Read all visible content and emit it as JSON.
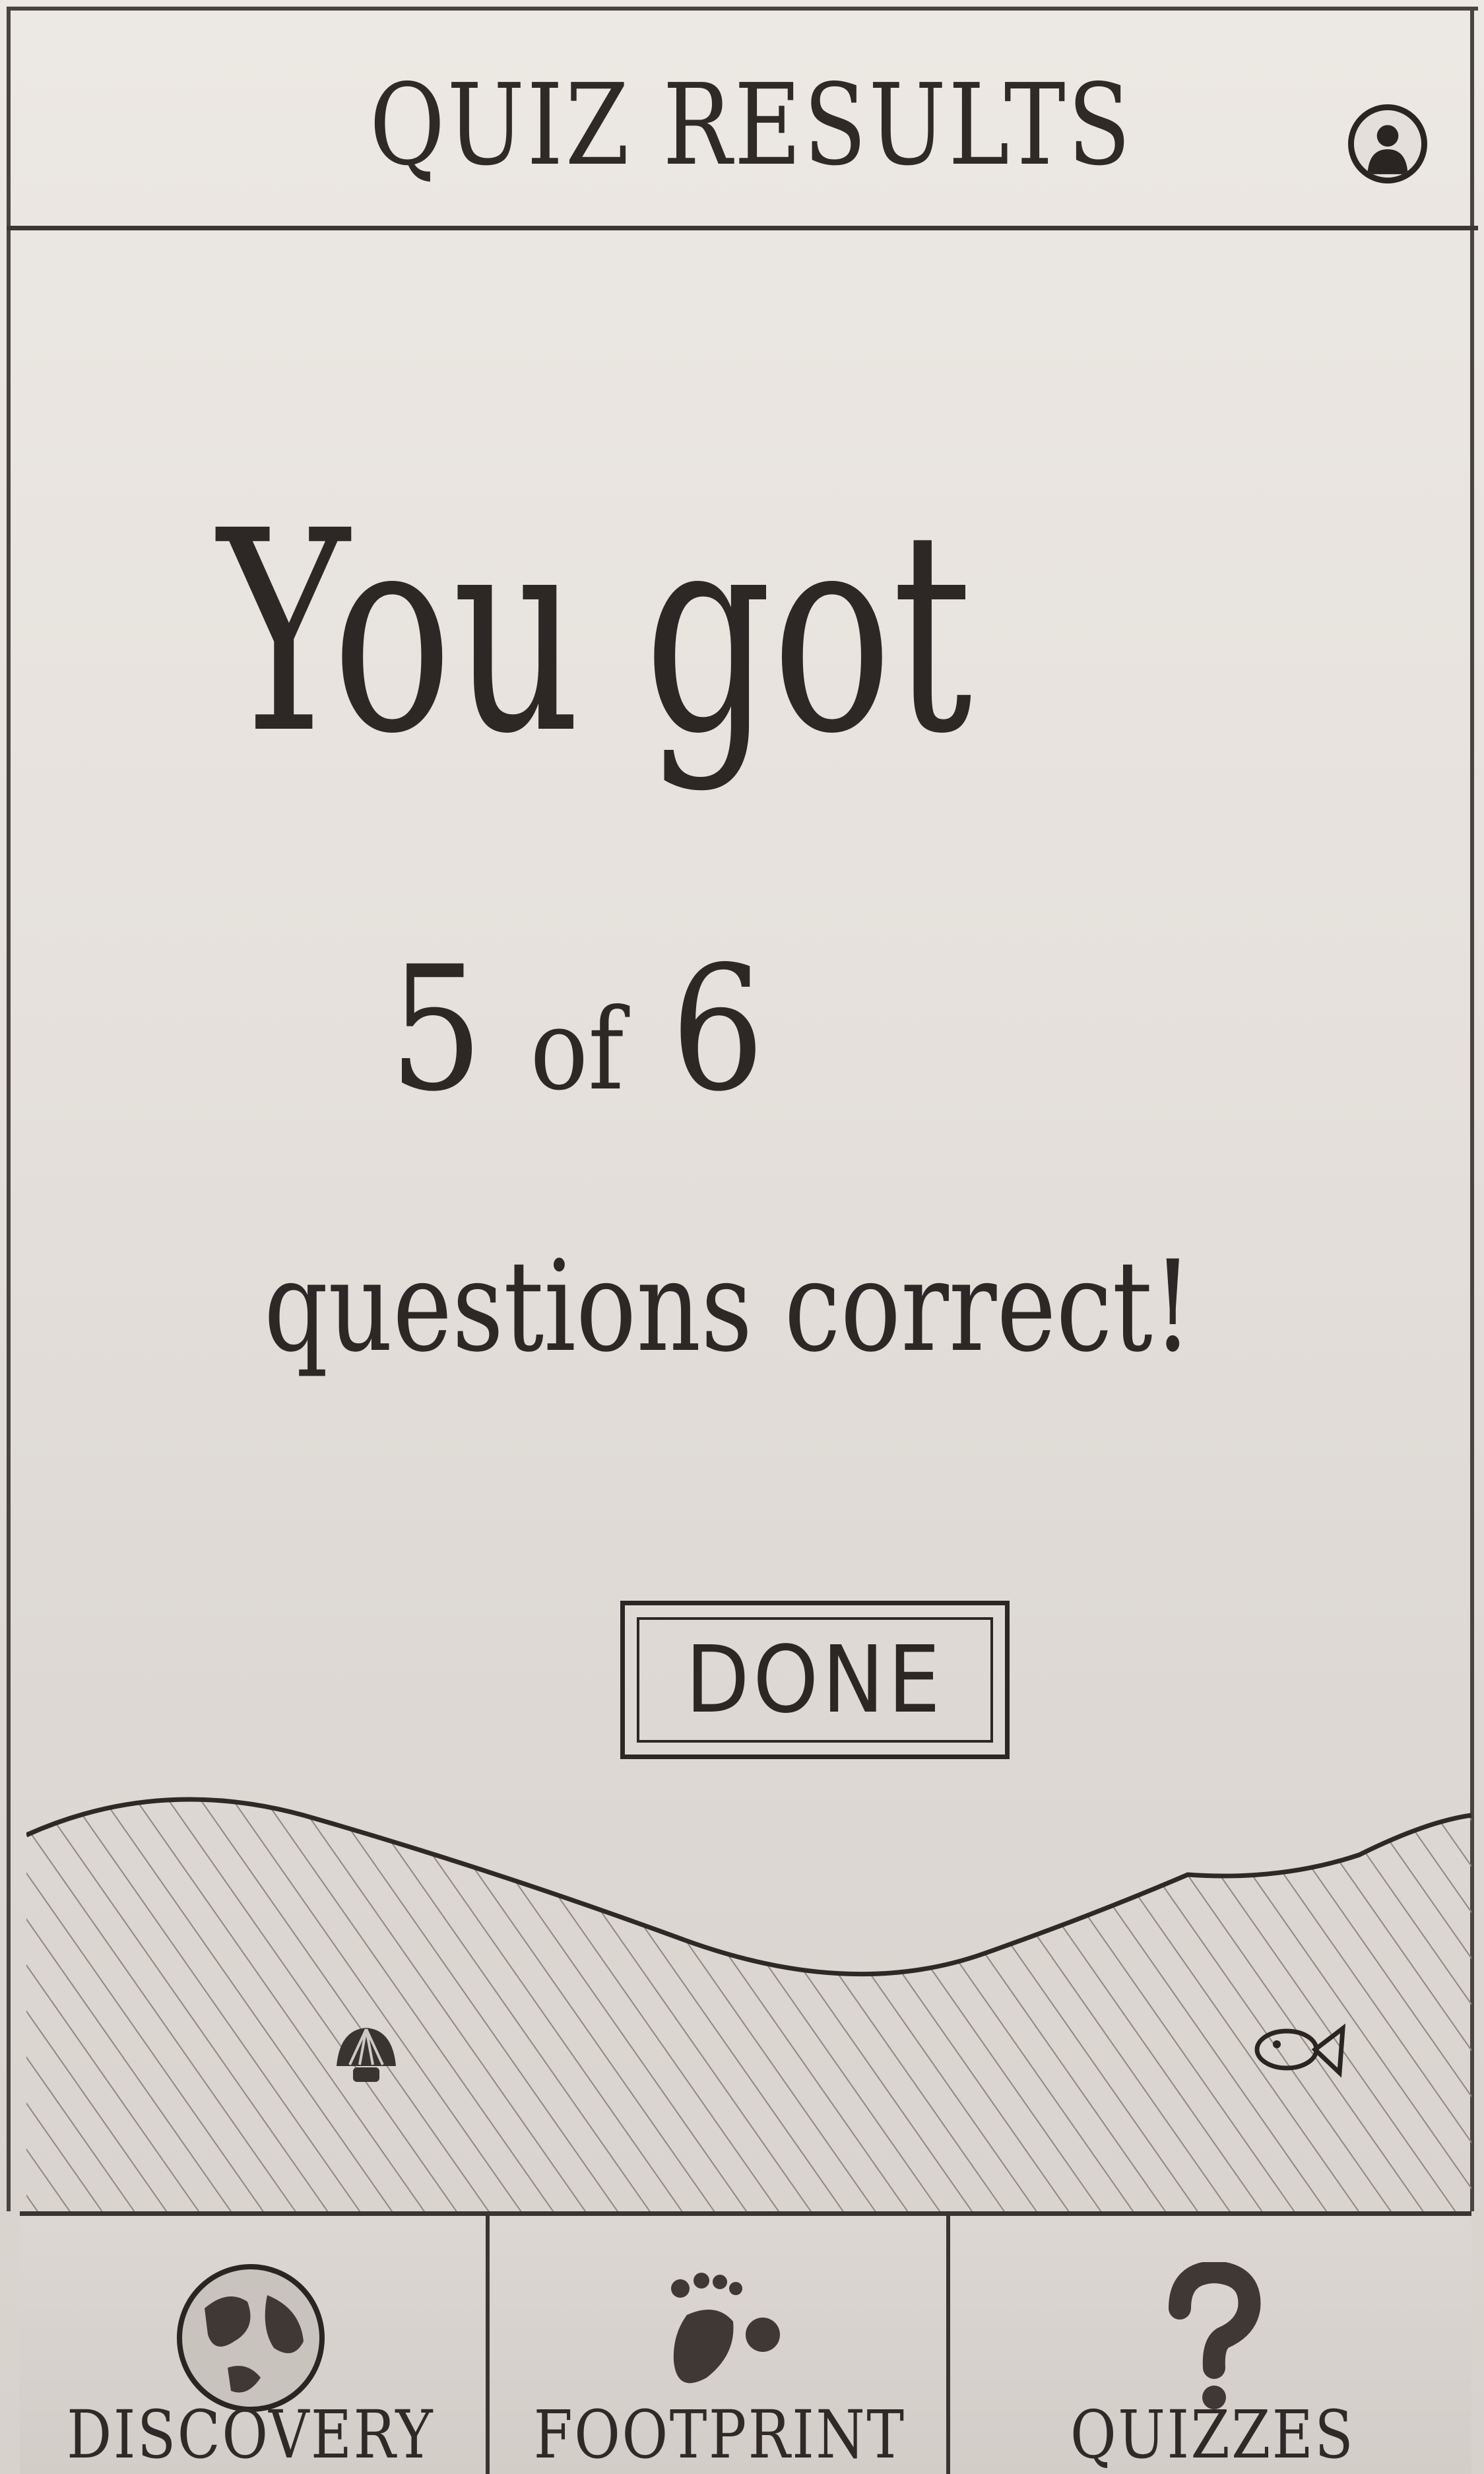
{
  "header": {
    "title": "QUIZ RESULTS",
    "profile_icon": "user-avatar-icon"
  },
  "result": {
    "line1": "You got",
    "score": "5",
    "of_text": "of",
    "total": "6",
    "line3": "questions correct!"
  },
  "actions": {
    "done_label": "DONE"
  },
  "decor": {
    "shell_icon": "shell-icon",
    "fish_icon": "fish-icon"
  },
  "tabs": [
    {
      "label": "DISCOVERY",
      "icon": "globe-icon"
    },
    {
      "label": "FOOTPRINT",
      "icon": "footprint-icon"
    },
    {
      "label": "QUIZZES",
      "icon": "question-mark-icon"
    }
  ],
  "colors": {
    "ink": "#2b2724",
    "paper": "#e9e4df"
  }
}
